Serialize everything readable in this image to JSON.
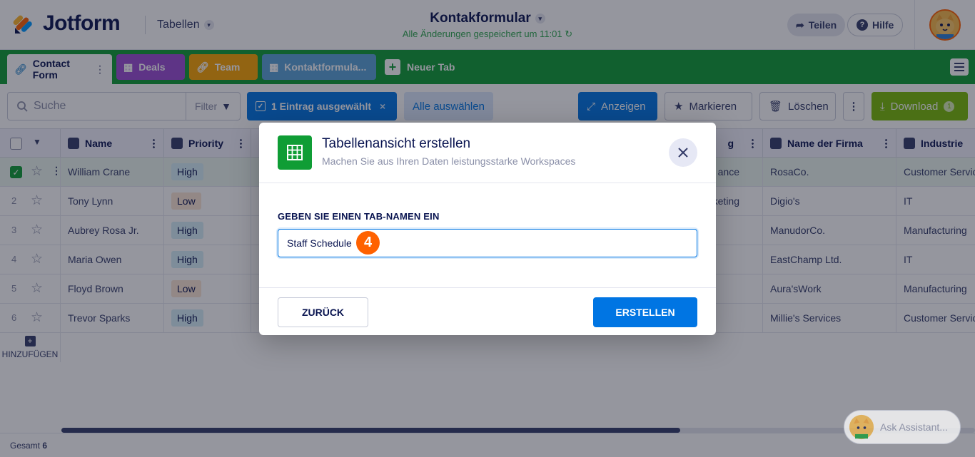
{
  "app": {
    "logo_text": "Jotform",
    "section_label": "Tabellen",
    "form_title": "Kontakformular",
    "saved_status": "Alle Änderungen gespeichert um 11:01",
    "share_label": "Teilen",
    "help_label": "Hilfe"
  },
  "tabs": [
    {
      "label": "Contact Form",
      "color": "#ffffff",
      "active": true,
      "icon": "link-icon"
    },
    {
      "label": "Deals",
      "color": "#9c4dd3",
      "active": false,
      "icon": "table-icon"
    },
    {
      "label": "Team",
      "color": "#f9a400",
      "active": false,
      "icon": "link-icon"
    },
    {
      "label": "Kontaktformula...",
      "color": "#5aa3d8",
      "active": false,
      "icon": "table-icon"
    }
  ],
  "new_tab_label": "Neuer Tab",
  "toolbar": {
    "search_placeholder": "Suche",
    "filter_label": "Filter",
    "selected_label": "1 Eintrag ausgewählt",
    "select_all_label": "Alle auswählen",
    "view_label": "Anzeigen",
    "mark_label": "Markieren",
    "delete_label": "Löschen",
    "download_label": "Download",
    "download_count": "1"
  },
  "table": {
    "columns": [
      "Name",
      "Priority",
      "g",
      "Name der Firma",
      "Industrie"
    ],
    "rows": [
      {
        "num": "",
        "name": "William Crane",
        "priority": "High",
        "dept": "ance",
        "company": "RosaCo.",
        "industry": "Customer Servic",
        "selected": true
      },
      {
        "num": "2",
        "name": "Tony Lynn",
        "priority": "Low",
        "dept": "keting",
        "company": "Digio's",
        "industry": "IT",
        "selected": false
      },
      {
        "num": "3",
        "name": "Aubrey Rosa Jr.",
        "priority": "High",
        "dept": "",
        "company": "ManudorCo.",
        "industry": "Manufacturing",
        "selected": false
      },
      {
        "num": "4",
        "name": "Maria Owen",
        "priority": "High",
        "dept": "",
        "company": "EastChamp Ltd.",
        "industry": "IT",
        "selected": false
      },
      {
        "num": "5",
        "name": "Floyd Brown",
        "priority": "Low",
        "dept": "",
        "company": "Aura'sWork",
        "industry": "Manufacturing",
        "selected": false
      },
      {
        "num": "6",
        "name": "Trevor Sparks",
        "priority": "High",
        "dept": "",
        "company": "Millie's Services",
        "industry": "Customer Servic",
        "selected": false
      }
    ],
    "add_label": "HINZUFÜGEN",
    "total_label": "Gesamt",
    "total_count": "6"
  },
  "assistant_label": "Ask Assistant...",
  "modal": {
    "title": "Tabellenansicht erstellen",
    "subtitle": "Machen Sie aus Ihren Daten leistungsstarke Workspaces",
    "field_label": "GEBEN SIE EINEN TAB-NAMEN EIN",
    "field_value": "Staff Schedule",
    "step_badge": "4",
    "back_label": "ZURÜCK",
    "create_label": "ERSTELLEN"
  },
  "colors": {
    "brand_green": "#0f9d35",
    "primary_blue": "#0075e3",
    "download_green": "#78bb07",
    "accent_orange": "#ff6100"
  }
}
